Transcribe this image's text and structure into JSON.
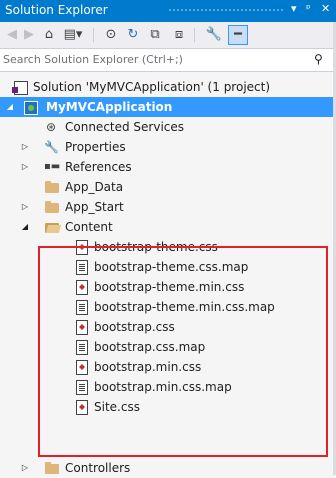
{
  "window": {
    "title": "Solution Explorer",
    "buttons": [
      "▾",
      "ᵖ",
      "✕"
    ]
  },
  "toolbar": {
    "back": "◀",
    "forward": "▶",
    "home": "⌂",
    "switch_views": "▤▾",
    "pending_changes": "⊙",
    "refresh": "↻",
    "collapse_all": "⧉",
    "show_all_files": "⧈",
    "properties": "🔧",
    "preview": "━"
  },
  "search": {
    "placeholder": "Search Solution Explorer (Ctrl+;)",
    "icon": "⚲"
  },
  "tree": {
    "solution": "Solution 'MyMVCApplication' (1 project)",
    "project": "MyMVCApplication",
    "items": {
      "connected_services": "Connected Services",
      "properties": "Properties",
      "references": "References",
      "app_data": "App_Data",
      "app_start": "App_Start",
      "content": "Content",
      "controllers": "Controllers"
    },
    "content_files": [
      "bootstrap-theme.css",
      "bootstrap-theme.css.map",
      "bootstrap-theme.min.css",
      "bootstrap-theme.min.css.map",
      "bootstrap.css",
      "bootstrap.css.map",
      "bootstrap.min.css",
      "bootstrap.min.css.map",
      "Site.css"
    ]
  },
  "colors": {
    "accent": "#007acc",
    "selection": "#3399ff",
    "highlight_box": "#e0202a",
    "folder": "#dcb67a"
  }
}
